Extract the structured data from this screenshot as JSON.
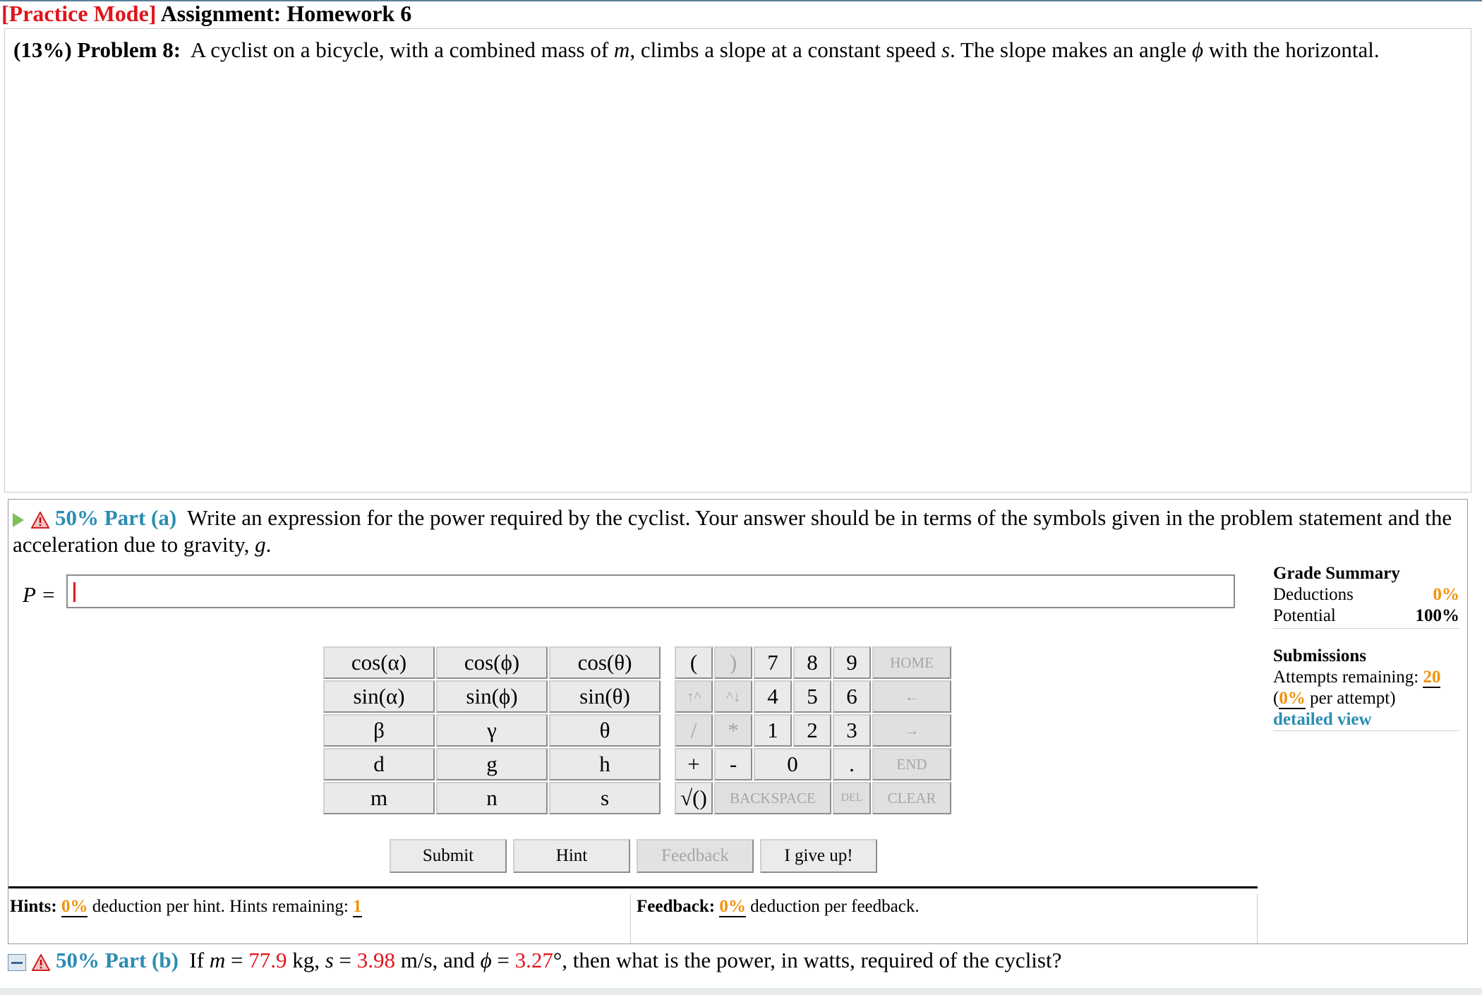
{
  "header": {
    "mode": "[Practice Mode]",
    "assignment": "Assignment: Homework 6"
  },
  "problem": {
    "weight": "(13%)",
    "label": "Problem 8:",
    "text_1": "A cyclist on a bicycle, with a combined mass of",
    "var_m": "m",
    "text_2": ", climbs a slope at a constant speed",
    "var_s": "s",
    "text_3": ". The slope makes an angle",
    "var_phi": "ϕ",
    "text_4": "with the horizontal."
  },
  "part_a": {
    "label": "50% Part (a)",
    "question": "Write an expression for the power required by the cyclist. Your answer should be in terms of the symbols given in the problem statement and the acceleration due to gravity,",
    "var_g": "g",
    "period": ".",
    "answer_label": "P =",
    "answer_value": ""
  },
  "grade_summary": {
    "title": "Grade Summary",
    "deductions_label": "Deductions",
    "deductions_value": "0%",
    "potential_label": "Potential",
    "potential_value": "100%",
    "submissions_title": "Submissions",
    "attempts_label": "Attempts remaining:",
    "attempts_value": "20",
    "per_attempt_open": "(",
    "per_attempt_value": "0%",
    "per_attempt_close": "per attempt)",
    "detailed_view": "detailed view"
  },
  "keypad": {
    "fn": [
      "cos(α)",
      "cos(ϕ)",
      "cos(θ)",
      "sin(α)",
      "sin(ϕ)",
      "sin(θ)",
      "β",
      "γ",
      "θ",
      "d",
      "g",
      "h",
      "m",
      "n",
      "s"
    ],
    "open_paren": "(",
    "close_paren": ")",
    "seven": "7",
    "eight": "8",
    "nine": "9",
    "home": "HOME",
    "up_caret": "↑^",
    "down_caret": "^↓",
    "four": "4",
    "five": "5",
    "six": "6",
    "left_arrow": "←",
    "slash": "/",
    "star": "*",
    "one": "1",
    "two": "2",
    "three": "3",
    "right_arrow": "→",
    "plus": "+",
    "minus": "-",
    "zero": "0",
    "dot": ".",
    "end": "END",
    "sqrt": "√()",
    "backspace": "BACKSPACE",
    "del": "DEL",
    "clear": "CLEAR"
  },
  "buttons": {
    "submit": "Submit",
    "hint": "Hint",
    "feedback": "Feedback",
    "give_up": "I give up!"
  },
  "hints": {
    "label": "Hints:",
    "value": "0%",
    "text": "deduction per hint. Hints remaining:",
    "remaining": "1"
  },
  "feedback": {
    "label": "Feedback:",
    "value": "0%",
    "text": "deduction per feedback."
  },
  "part_b": {
    "label": "50% Part (b)",
    "if": "If",
    "m_var": "m",
    "eq": "=",
    "m_val": "77.9",
    "m_unit": "kg,",
    "s_var": "s",
    "s_val": "3.98",
    "s_unit": "m/s, and",
    "phi_var": "ϕ",
    "phi_val": "3.27",
    "phi_unit": "°, then what is the power, in watts, required of the cyclist?"
  },
  "colors": {
    "accent_teal": "#2b8db3",
    "alert_red": "#e0141b",
    "value_orange": "#f0920c"
  }
}
